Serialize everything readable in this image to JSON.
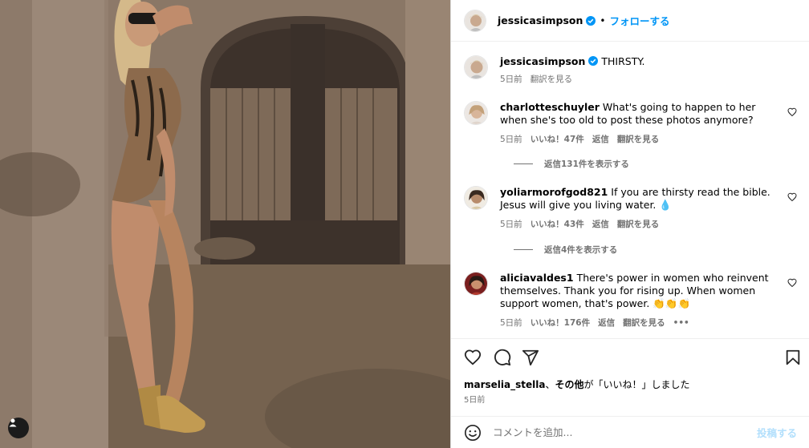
{
  "header": {
    "username": "jessicasimpson",
    "dot": "•",
    "follow_label": "フォローする"
  },
  "caption": {
    "username": "jessicasimpson",
    "text": "THIRSTY.",
    "time": "5日前",
    "translate": "翻訳を見る"
  },
  "comments": [
    {
      "username": "charlotteschuyler",
      "text": "What's going to happen to her when she's too old to post these photos anymore?",
      "time": "5日前",
      "likes": "いいね！47件",
      "reply": "返信",
      "translate": "翻訳を見る",
      "view_replies": "返信131件を表示する"
    },
    {
      "username": "yoliarmorofgod821",
      "text": "If you are thirsty read the bible. Jesus will give you living water. 💧",
      "time": "5日前",
      "likes": "いいね！43件",
      "reply": "返信",
      "translate": "翻訳を見る",
      "view_replies": "返信4件を表示する"
    },
    {
      "username": "aliciavaldes1",
      "text": "There's power in women who reinvent themselves. Thank you for rising up. When women support women, that's power. 👏👏👏",
      "time": "5日前",
      "likes": "いいね！176件",
      "reply": "返信",
      "translate": "翻訳を見る",
      "more": "•••"
    }
  ],
  "likes_line": {
    "user": "marselia_stella",
    "sep": "、",
    "others": "その他",
    "suffix": "が「いいね！」しました"
  },
  "post_date": "5日前",
  "add_comment": {
    "placeholder": "コメントを追加...",
    "post_label": "投稿する"
  },
  "icons": {
    "verified": "verified-badge-icon",
    "like": "heart-icon",
    "comment": "comment-icon",
    "share": "paper-plane-icon",
    "save": "bookmark-icon",
    "emoji": "smiley-icon",
    "user_tag": "user-tag-icon"
  },
  "colors": {
    "accent": "#0095f6",
    "verified": "#0095f6",
    "secondary_text": "#737373",
    "post_disabled": "#b2dffc"
  }
}
